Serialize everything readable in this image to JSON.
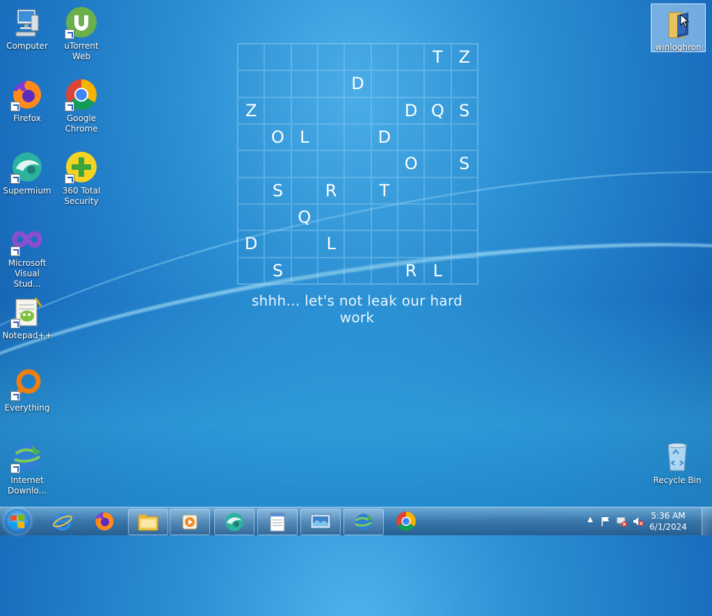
{
  "desktop": {
    "icons": [
      {
        "label": "Computer",
        "icon": "computer-icon"
      },
      {
        "label": "uTorrent Web",
        "icon": "utorrent-icon"
      },
      {
        "label": "Firefox",
        "icon": "firefox-icon"
      },
      {
        "label": "Google Chrome",
        "icon": "chrome-icon"
      },
      {
        "label": "Supermium",
        "icon": "supermium-icon"
      },
      {
        "label": "360 Total Security",
        "icon": "360-security-icon"
      },
      {
        "label": "Microsoft Visual Stud...",
        "icon": "visual-studio-icon"
      },
      {
        "label": "Notepad++",
        "icon": "notepadpp-icon"
      },
      {
        "label": "Everything",
        "icon": "everything-icon"
      },
      {
        "label": "Internet Downlo...",
        "icon": "idm-icon"
      },
      {
        "label": "winloghron",
        "icon": "folder-icon"
      },
      {
        "label": "Recycle Bin",
        "icon": "recycle-bin-icon"
      }
    ]
  },
  "wallpaper": {
    "grid": [
      [
        "",
        "",
        "",
        "",
        "",
        "",
        "",
        "T",
        "Z"
      ],
      [
        "",
        "",
        "",
        "",
        "D",
        "",
        "",
        "",
        ""
      ],
      [
        "Z",
        "",
        "",
        "",
        "",
        "",
        "D",
        "Q",
        "S"
      ],
      [
        "",
        "O",
        "L",
        "",
        "",
        "D",
        "",
        "",
        ""
      ],
      [
        "",
        "",
        "",
        "",
        "",
        "",
        "O",
        "",
        "S"
      ],
      [
        "",
        "S",
        "",
        "R",
        "",
        "T",
        "",
        "",
        ""
      ],
      [
        "",
        "",
        "Q",
        "",
        "",
        "",
        "",
        "",
        ""
      ],
      [
        "D",
        "",
        "",
        "L",
        "",
        "",
        "",
        "",
        ""
      ],
      [
        "",
        "S",
        "",
        "",
        "",
        "",
        "R",
        "L",
        ""
      ]
    ],
    "caption": "shhh... let's not leak our hard work"
  },
  "taskbar": {
    "pinned": [
      "start-orb",
      "internet-explorer-icon",
      "firefox-icon",
      "file-explorer-icon",
      "media-player-icon",
      "supermium-icon",
      "notepad-icon",
      "screen-icon",
      "idm-icon",
      "chrome-icon"
    ],
    "clock": {
      "time": "5:36 AM",
      "date": "6/1/2024"
    }
  }
}
